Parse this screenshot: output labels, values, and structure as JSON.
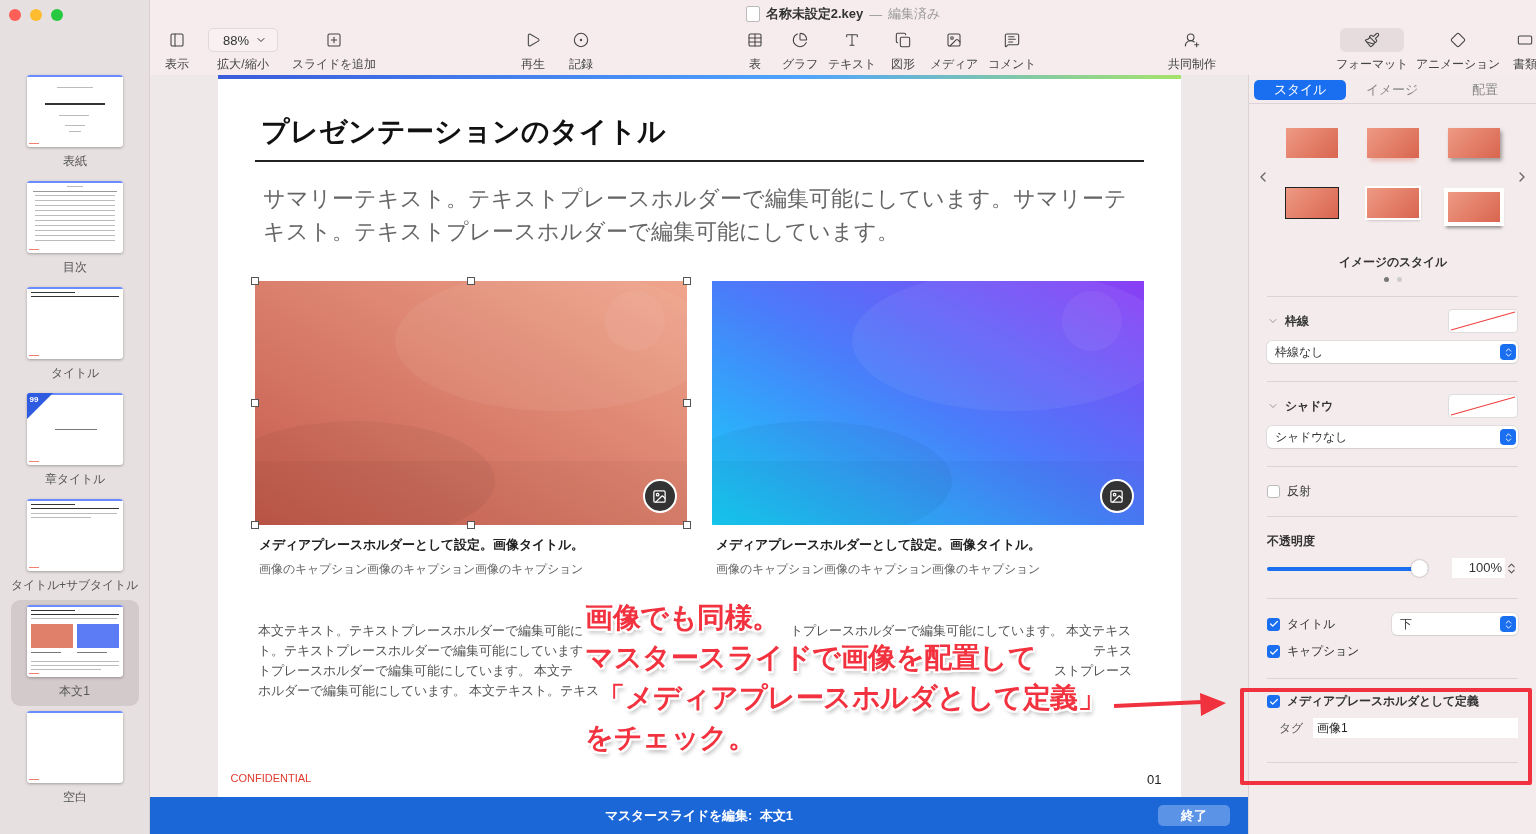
{
  "window": {
    "title": "名称未設定2.key",
    "separator": "—",
    "status": "編集済み"
  },
  "toolbar": {
    "groups": [
      {
        "items": [
          {
            "kind": "button",
            "label": "表示"
          },
          {
            "kind": "zoom",
            "value": "88%",
            "label": "拡大/縮小"
          },
          {
            "kind": "button",
            "label": "スライドを追加"
          }
        ]
      },
      {
        "items": [
          {
            "kind": "button",
            "label": "再生"
          },
          {
            "kind": "button",
            "label": "記録"
          }
        ]
      },
      {
        "items": [
          {
            "kind": "button",
            "label": "表"
          },
          {
            "kind": "button",
            "label": "グラフ"
          },
          {
            "kind": "button",
            "label": "テキスト"
          },
          {
            "kind": "button",
            "label": "図形"
          },
          {
            "kind": "button",
            "label": "メディア"
          },
          {
            "kind": "button",
            "label": "コメント"
          }
        ]
      },
      {
        "items": [
          {
            "kind": "button",
            "label": "共同制作"
          }
        ]
      },
      {
        "items": [
          {
            "kind": "button",
            "label": "フォーマット",
            "selected": true
          },
          {
            "kind": "button",
            "label": "アニメーション",
            "selected": false
          },
          {
            "kind": "button",
            "label": "書類",
            "selected": false
          }
        ]
      }
    ]
  },
  "sidebar": {
    "slides": [
      {
        "kind": "cover",
        "label": "表紙",
        "selected": false
      },
      {
        "kind": "toc",
        "label": "目次",
        "selected": false
      },
      {
        "kind": "title",
        "label": "タイトル",
        "selected": false
      },
      {
        "kind": "chapter",
        "label": "章タイトル",
        "badge": "99",
        "selected": false
      },
      {
        "kind": "subtitle",
        "label": "タイトル+サブタイトル",
        "selected": false
      },
      {
        "kind": "body",
        "label": "本文1",
        "selected": true
      },
      {
        "kind": "blank",
        "label": "空白",
        "selected": false
      }
    ]
  },
  "slide": {
    "title": "プレゼンテーションのタイトル",
    "summary": "サマリーテキスト。テキストプレースホルダーで編集可能にしています。サマリーテキスト。テキストプレースホルダーで編集可能にしています。",
    "images": [
      {
        "kind": "warm",
        "selected": true,
        "title": "メディアプレースホルダーとして設定。画像タイトル。",
        "caption": "画像のキャプション画像のキャプション画像のキャプション"
      },
      {
        "kind": "cool",
        "selected": false,
        "title": "メディアプレースホルダーとして設定。画像タイトル。",
        "caption": "画像のキャプション画像のキャプション画像のキャプション"
      }
    ],
    "body_lines": [
      {
        "start": "本文テキスト。テキストプレースホルダーで編集可能に",
        "end": "トプレースホルダーで編集可能にしています。 本文テキス"
      },
      {
        "start": "ト。テキストプレースホルダーで編集可能にしています",
        "end": "テキス"
      },
      {
        "start": "トプレースホルダーで編集可能にしています。 本文テ",
        "end": "ストプレース"
      },
      {
        "start": "ホルダーで編集可能にしています。 本文テキスト。テキス"
      }
    ],
    "footer": "CONFIDENTIAL",
    "page": "01"
  },
  "master_bar": {
    "label": "マスタースライドを編集:  本文1",
    "button": "終了"
  },
  "inspector": {
    "tabs": [
      {
        "label": "スタイル",
        "selected": true
      },
      {
        "label": "イメージ",
        "selected": false
      },
      {
        "label": "配置",
        "selected": false
      }
    ],
    "presets": [
      {
        "kind": "plain"
      },
      {
        "kind": "reflection"
      },
      {
        "kind": "shadow"
      },
      {
        "kind": "outline"
      },
      {
        "kind": "frame"
      },
      {
        "kind": "curl"
      }
    ],
    "presets_caption": "イメージのスタイル",
    "pages": [
      {
        "selected": true
      },
      {
        "selected": false
      }
    ],
    "border": {
      "label": "枠線",
      "expanded": true,
      "value": "枠線なし"
    },
    "shadow": {
      "label": "シャドウ",
      "expanded": true,
      "value": "シャドウなし"
    },
    "reflection": {
      "label": "反射",
      "checked": false
    },
    "opacity": {
      "label": "不透明度",
      "level": 1,
      "reading": "100%"
    },
    "title_option": {
      "label": "タイトル",
      "checked": true,
      "value": "下"
    },
    "caption_option": {
      "label": "キャプション",
      "checked": true
    },
    "placeholder_option": {
      "label": "メディアプレースホルダとして定義",
      "checked": true,
      "tag_label": "タグ",
      "tag_value": "画像1"
    }
  },
  "annotation": {
    "lines": [
      "画像でも同様。",
      "マスタースライドで画像を配置して",
      "「メディアプレースホルダとして定義」",
      "をチェック。"
    ]
  }
}
